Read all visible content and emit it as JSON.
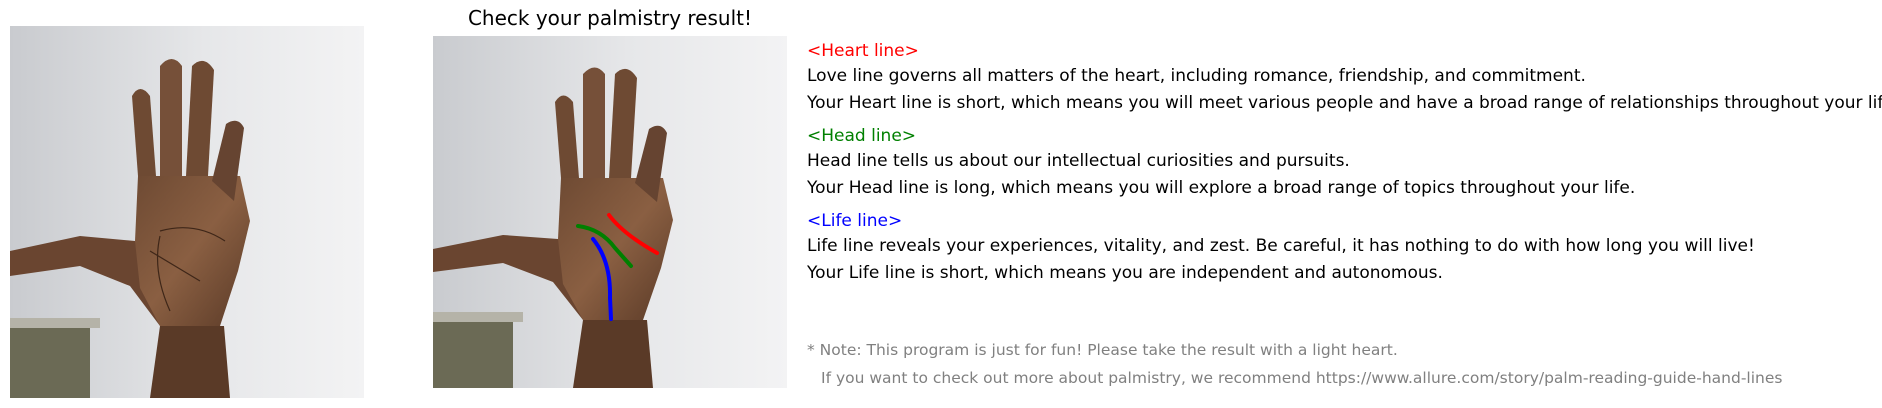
{
  "result_title": "Check your palmistry result!",
  "images": {
    "original": {
      "icon": "palm-photo"
    },
    "result": {
      "icon": "palm-photo-with-lines"
    }
  },
  "colors": {
    "heart": "#ff0000",
    "head": "#008000",
    "life": "#0000ff",
    "note": "#808080"
  },
  "sections": {
    "heart": {
      "title": "<Heart line>",
      "description": "Love line governs all matters of the heart, including romance, friendship, and commitment.",
      "result": "Your Heart line is short, which means you will meet various people and have a broad range of relationships throughout your life."
    },
    "head": {
      "title": "<Head line>",
      "description": "Head line tells us about our intellectual curiosities and pursuits.",
      "result": "Your Head line is long, which means you will explore a broad range of topics throughout your life."
    },
    "life": {
      "title": "<Life line>",
      "description": "Life line reveals your experiences, vitality, and zest. Be careful, it has nothing to do with how long you will live!",
      "result": "Your Life line is short, which means you are independent and autonomous."
    }
  },
  "note": {
    "line1": "* Note: This program is just for fun! Please take the result with a light heart.",
    "line2": "If you want to check out more about palmistry, we recommend https://www.allure.com/story/palm-reading-guide-hand-lines"
  }
}
